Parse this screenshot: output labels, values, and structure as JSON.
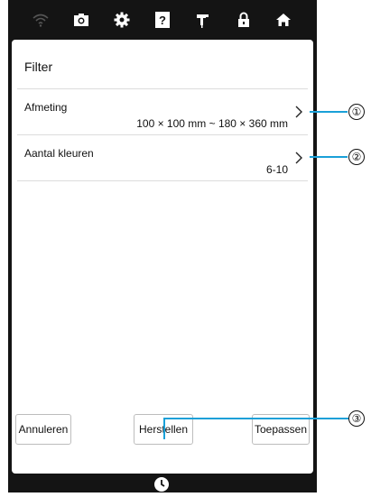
{
  "status_bar": {
    "icons": [
      "wifi-icon",
      "camera-icon",
      "gear-icon",
      "help-icon",
      "needle-icon",
      "lock-icon",
      "home-icon"
    ]
  },
  "dialog": {
    "title": "Filter",
    "rows": [
      {
        "label": "Afmeting",
        "value": "100 × 100 mm ~ 180 × 360 mm"
      },
      {
        "label": "Aantal kleuren",
        "value": "6-10"
      }
    ],
    "buttons": {
      "cancel": "Annuleren",
      "reset": "Herstellen",
      "apply": "Toepassen"
    }
  },
  "callouts": [
    "①",
    "②",
    "③"
  ],
  "colors": {
    "frame": "#141414",
    "callout_line": "#1aa0d8",
    "divider": "#dcdcdc"
  }
}
